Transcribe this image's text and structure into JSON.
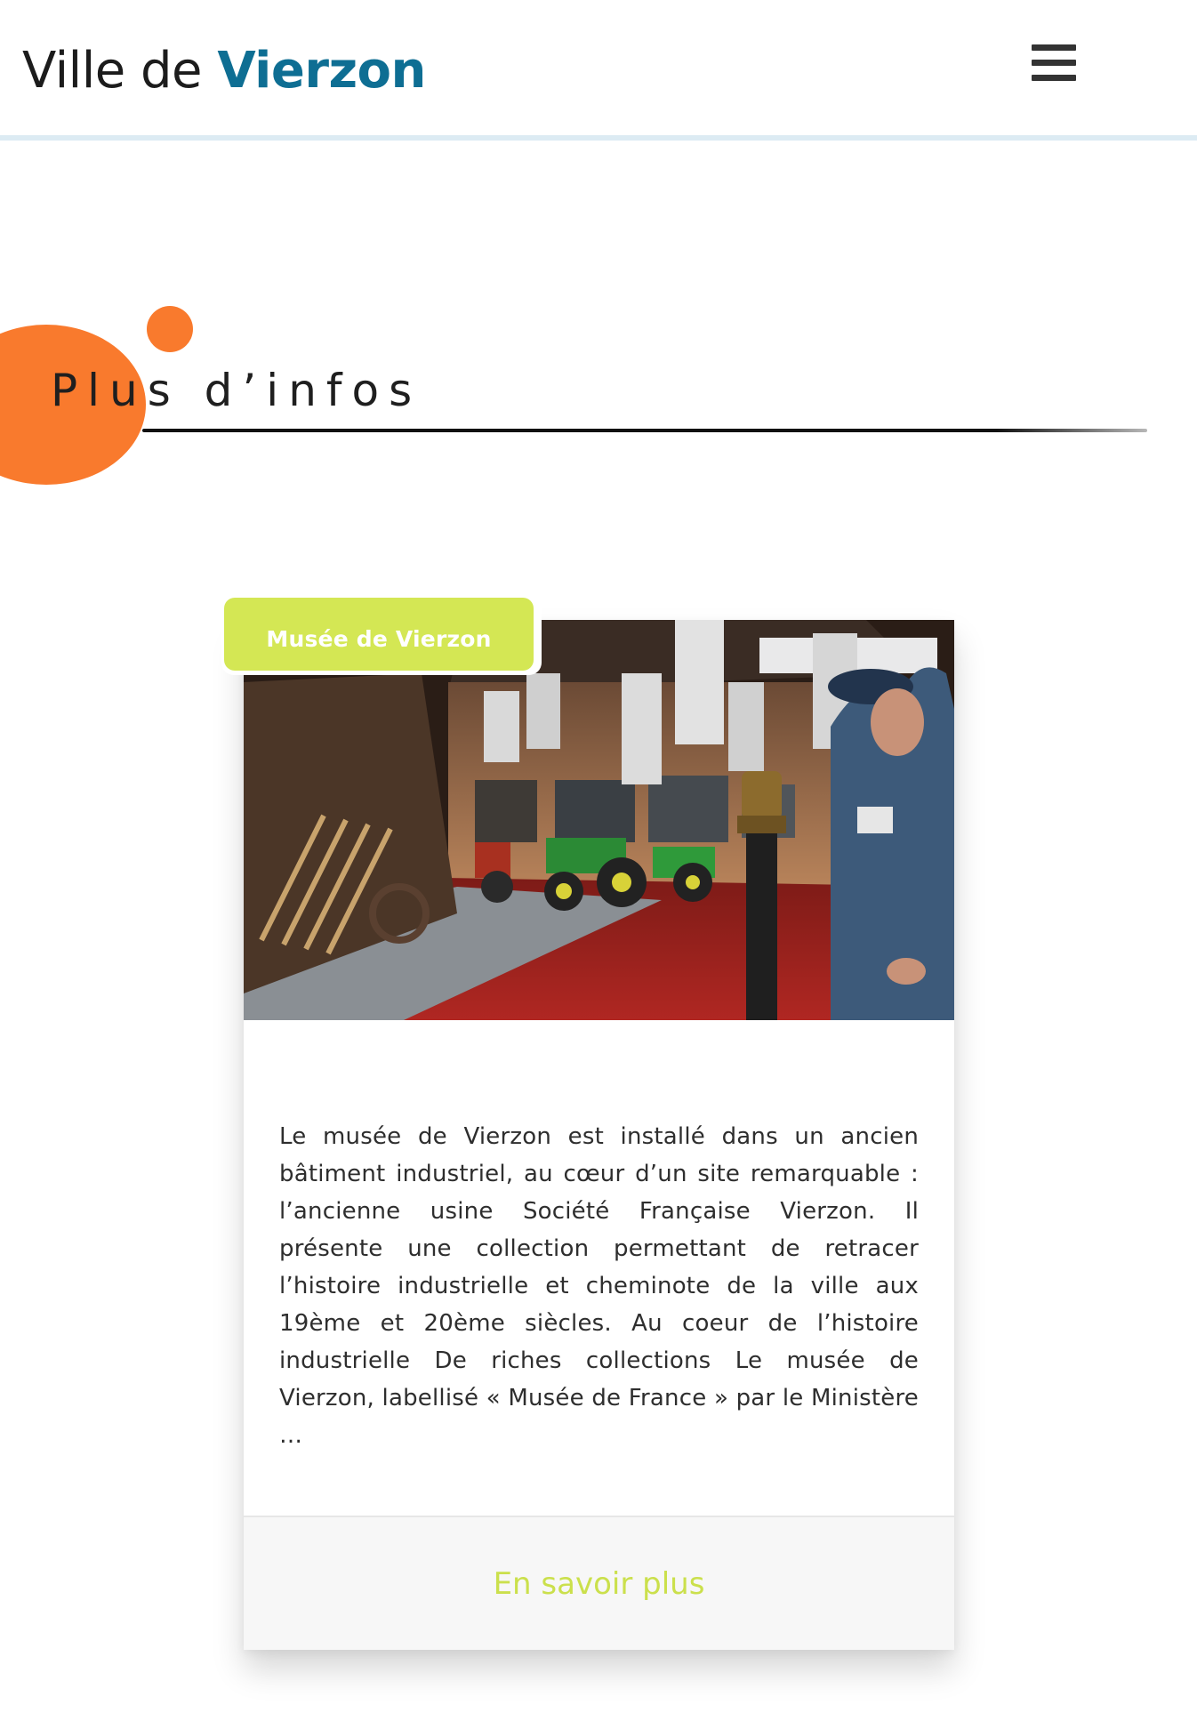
{
  "header": {
    "title_prefix": "Ville de ",
    "title_brand": "Vierzon",
    "menu_icon": "hamburger-menu-icon"
  },
  "section": {
    "title": "Plus d’infos"
  },
  "card": {
    "tag": "Musée de Vierzon",
    "image_alt": "Intérieur du musée de Vierzon : tracteurs et machines agricoles",
    "text": "Le musée de Vierzon est installé dans un ancien bâtiment industriel, au cœur d’un site remarquable : l’ancienne usine Société Française Vierzon. Il présente une collection permettant de retracer l’histoire industrielle et cheminote de la ville aux 19ème et 20ème siècles. Au coeur de l’histoire industrielle De riches collections Le musée de Vierzon, labellisé « Musée de France » par le Ministère …",
    "link_label": "En savoir plus"
  },
  "colors": {
    "brand_blue": "#0e6e93",
    "accent_orange": "#f97a2d",
    "accent_lime": "#d4e754",
    "link_lime": "#cbe04c"
  }
}
